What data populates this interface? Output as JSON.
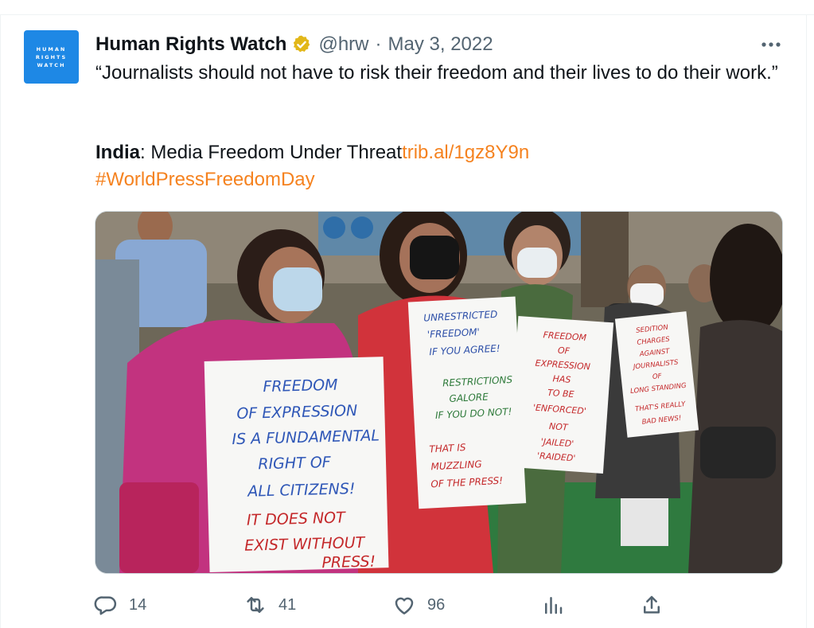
{
  "author": {
    "avatar_lines": [
      "HUMAN",
      "RIGHTS",
      "WATCH"
    ],
    "name": "Human Rights Watch",
    "handle": "@hrw",
    "separator": "·",
    "date": "May 3, 2022"
  },
  "tweet": {
    "quote": "“Journalists should not have to risk their freedom and their lives to do their work.”",
    "country": "India",
    "headline": ": Media Freedom Under Threat",
    "link": "trib.al/1gz8Y9n",
    "hashtag": "#WorldPressFreedomDay"
  },
  "image": {
    "signs": {
      "left": [
        "FREEDOM",
        "OF EXPRESSION",
        "IS A FUNDAMENTAL",
        "RIGHT OF",
        "ALL CITIZENS!",
        "IT DOES NOT",
        "EXIST WITHOUT",
        "PRESS!"
      ],
      "middle": [
        "UNRESTRICTED",
        "'FREEDOM'",
        "IF YOU AGREE!",
        "RESTRICTIONS",
        "GALORE",
        "IF YOU DO NOT!",
        "THAT IS",
        "MUZZLING",
        "OF THE PRESS!"
      ],
      "center_right": [
        "FREEDOM",
        "OF",
        "EXPRESSION",
        "HAS",
        "TO BE",
        "'ENFORCED'",
        "NOT",
        "'JAILED'",
        "'RAIDED'"
      ],
      "right": [
        "SEDITION",
        "CHARGES",
        "AGAINST",
        "JOURNALISTS",
        "OF",
        "LONG STANDING",
        "THAT'S REALLY",
        "BAD NEWS!"
      ]
    }
  },
  "actions": {
    "replies": "14",
    "retweets": "41",
    "likes": "96"
  },
  "colors": {
    "link": "#f5821f",
    "verified_badge": "#e2b719",
    "brand": "#1e88e5",
    "muted": "#536471"
  }
}
